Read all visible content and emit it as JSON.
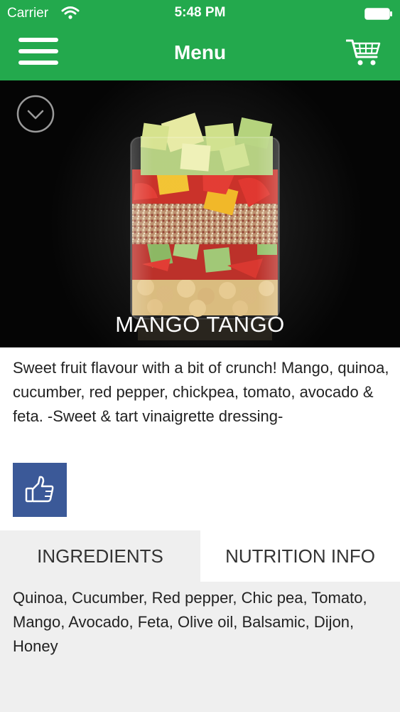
{
  "status_bar": {
    "carrier": "Carrier",
    "time": "5:48 PM"
  },
  "nav": {
    "title": "Menu"
  },
  "item": {
    "name": "MANGO TANGO",
    "description": "Sweet fruit flavour with a bit of crunch! Mango, quinoa, cucumber, red pepper, chickpea, tomato, avocado & feta. -Sweet & tart vinaigrette dressing-"
  },
  "tabs": [
    {
      "label": "INGREDIENTS",
      "selected": true
    },
    {
      "label": "NUTRITION INFO",
      "selected": false
    }
  ],
  "ingredients": "Quinoa, Cucumber,  Red pepper, Chic pea, Tomato, Mango, Avocado, Feta, Olive oil, Balsamic, Dijon, Honey",
  "colors": {
    "header_green": "#23a94d",
    "like_blue": "#3b5998",
    "tab_selected_bg": "#efefef",
    "tab_unselected_bg": "#ffffff"
  },
  "icons": {
    "menu": "hamburger-icon",
    "cart": "shopping-cart-icon",
    "collapse": "chevron-down-circle-icon",
    "like": "thumbs-up-icon"
  }
}
